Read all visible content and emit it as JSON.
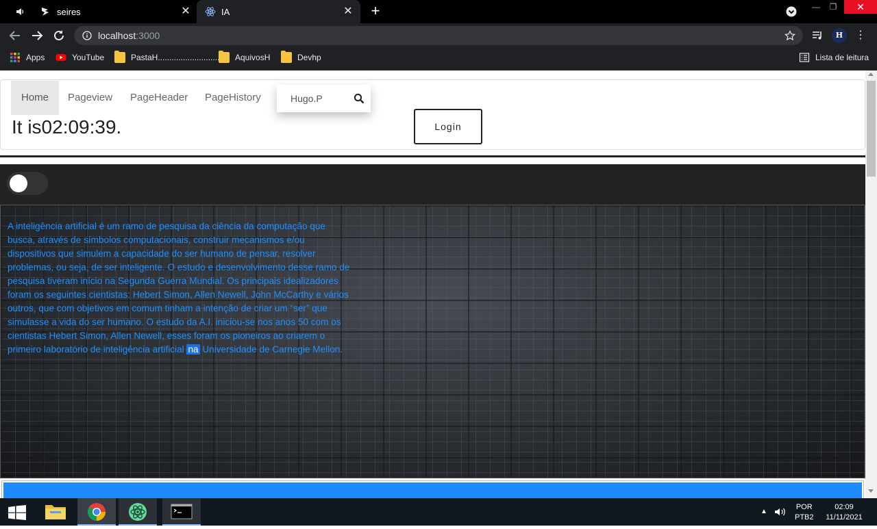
{
  "browser": {
    "tabs": [
      {
        "title": "seires",
        "active": false
      },
      {
        "title": "IA",
        "active": true
      }
    ],
    "new_tab": "+",
    "url_host": "localhost",
    "url_port": ":3000",
    "profile_initial": "H",
    "menu_dots": "⋮",
    "bookmarks": [
      {
        "label": "Apps"
      },
      {
        "label": "YouTube"
      },
      {
        "label": "PastaH.............................."
      },
      {
        "label": "AquivosH"
      },
      {
        "label": "Devhp"
      }
    ],
    "reading_list": "Lista de leitura",
    "colors": {
      "chrome_dark": "#202124",
      "tab_bar": "#000000",
      "close_red": "#e81123"
    }
  },
  "page": {
    "nav": {
      "items": [
        {
          "label": "Home",
          "active": true
        },
        {
          "label": "Pageview"
        },
        {
          "label": "PageHeader"
        },
        {
          "label": "PageHistory"
        }
      ],
      "search_value": "Hugo.P"
    },
    "clock_text": "It is02:09:39.",
    "login_label": "Login",
    "toggle_on": false,
    "hero_text_before": "A inteligência artificial é um ramo de pesquisa da ciência da computação que busca, através de símbolos computacionais, construir mecanismos e/ou dispositivos que simulem a capacidade do ser humano de pensar, resolver problemas, ou seja, de ser inteligente. O estudo e desenvolvimento desse ramo de pesquisa tiveram início na Segunda Guerra Mundial. Os principais idealizadores foram os seguintes cientistas: Hebert Simon, Allen Newell, John McCarthy e vários outros, que com objetivos em comum tinham a intenção de criar um “ser” que simulasse a vida do ser humano. O estudo da A.I. iniciou-se nos anos 50 com os cientistas Hebert Simon, Allen Newell, esses foram os pioneiros ao criarem o primeiro laboratório de inteligência artificial",
    "hero_text_highlight": "na",
    "hero_text_after": "Universidade de Carnegie Mellon.",
    "colors": {
      "hero_text": "#1e90ff",
      "blue_box": "#1e8cff",
      "strip": "#222222"
    }
  },
  "taskbar": {
    "lang_line1": "POR",
    "lang_line2": "PTB2",
    "time": "02:09",
    "date": "11/11/2021"
  }
}
